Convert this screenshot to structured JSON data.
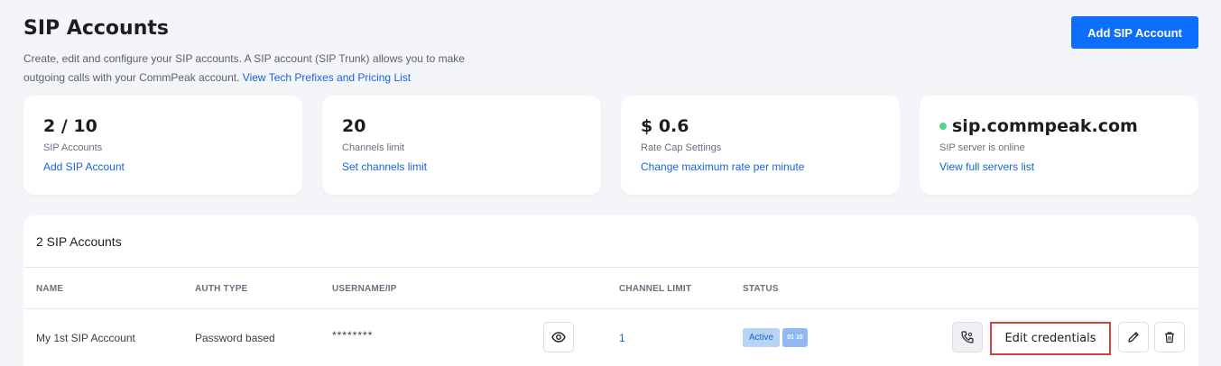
{
  "header": {
    "title": "SIP Accounts",
    "description": "Create, edit and configure your SIP accounts. A SIP account (SIP Trunk) allows you to make outgoing calls with your CommPeak account.",
    "description_link": "View Tech Prefixes and Pricing List",
    "add_button": "Add SIP Account"
  },
  "cards": [
    {
      "value": "2 / 10",
      "label": "SIP Accounts",
      "link": "Add SIP Account"
    },
    {
      "value": "20",
      "label": "Channels limit",
      "link": "Set channels limit"
    },
    {
      "value": "$ 0.6",
      "label": "Rate Cap Settings",
      "link": "Change maximum rate per minute"
    },
    {
      "value": "sip.commpeak.com",
      "label": "SIP server is online",
      "link": "View full servers list",
      "status_color": "#55d38a"
    }
  ],
  "table": {
    "title": "2 SIP Accounts",
    "columns": [
      "NAME",
      "AUTH TYPE",
      "USERNAME/IP",
      "CHANNEL LIMIT",
      "STATUS"
    ],
    "rows": [
      {
        "name": "My 1st SIP Acccount",
        "auth_type": "Password based",
        "username": "********",
        "channel_limit": "1",
        "status": "Active",
        "status_icon_text": "01 10",
        "edit_credentials": "Edit credentials"
      }
    ]
  },
  "icons": [
    "eye-icon",
    "phone-settings-icon",
    "pencil-icon",
    "trash-icon",
    "binary-icon"
  ],
  "colors": {
    "primary": "#0d6efd",
    "link": "#1565d8",
    "online": "#55d38a",
    "highlight": "#d9433f",
    "badge_bg": "#b9d3f5",
    "badge_text": "#1565d8"
  }
}
